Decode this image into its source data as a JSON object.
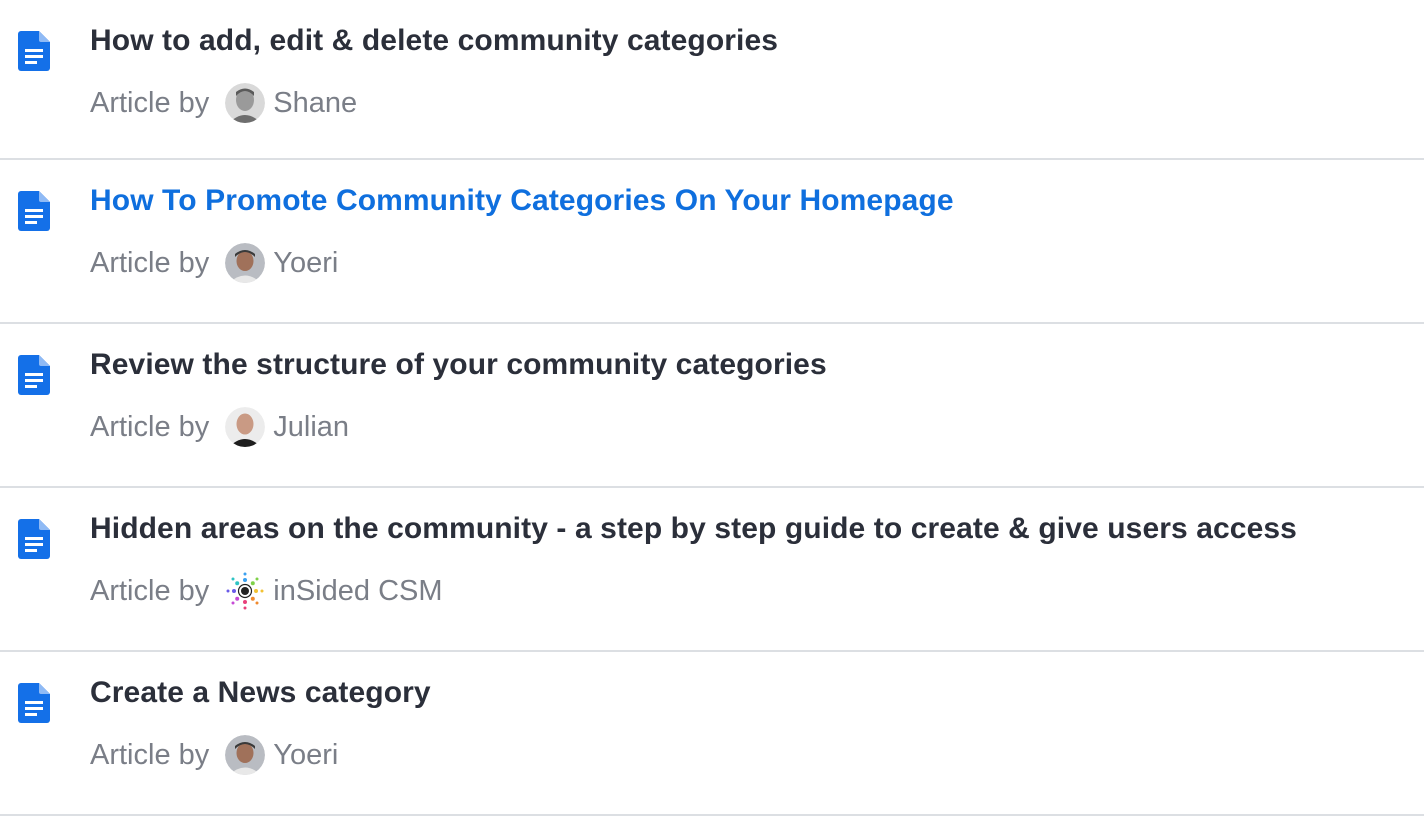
{
  "articles": [
    {
      "title": "How to add, edit & delete community categories",
      "prefix": "Article by",
      "author": "Shane",
      "avatar": "avatar-shane"
    },
    {
      "title": "How To Promote Community Categories On Your Homepage",
      "prefix": "Article by",
      "author": "Yoeri",
      "avatar": "avatar-yoeri",
      "state": "hovered-link"
    },
    {
      "title": "Review the structure of your community categories",
      "prefix": "Article by",
      "author": "Julian",
      "avatar": "avatar-julian"
    },
    {
      "title": "Hidden areas on the community - a step by step guide to create & give users access",
      "prefix": "Article by",
      "author": "inSided CSM",
      "avatar": "avatar-insided-logo"
    },
    {
      "title": "Create a News category",
      "prefix": "Article by",
      "author": "Yoeri",
      "avatar": "avatar-yoeri"
    }
  ],
  "colors": {
    "title": "#2b2f3a",
    "title_link": "#0f6fde",
    "meta": "#7a7e87",
    "icon": "#1470e8",
    "divider": "#dcdfe3"
  },
  "icons": {
    "article": "document-icon"
  }
}
